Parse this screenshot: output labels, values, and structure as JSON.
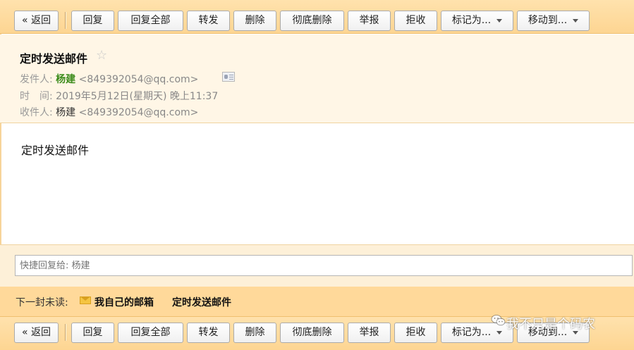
{
  "toolbar": {
    "back": "« 返回",
    "reply": "回复",
    "reply_all": "回复全部",
    "forward": "转发",
    "delete": "删除",
    "delete_permanent": "彻底删除",
    "report": "举报",
    "reject": "拒收",
    "mark_as": "标记为...",
    "move_to": "移动到..."
  },
  "mail": {
    "subject": "定时发送邮件",
    "star": "☆",
    "from_label": "发件人:",
    "from_name": "杨建",
    "from_email": "<849392054@qq.com>",
    "time_label": "时　间:",
    "time_value": "2019年5月12日(星期天) 晚上11:37",
    "to_label": "收件人:",
    "to_name": "杨建",
    "to_email": "<849392054@qq.com>",
    "body": "定时发送邮件"
  },
  "quick_reply": {
    "placeholder": "快捷回复给: 杨建"
  },
  "next_unread": {
    "label": "下一封未读:",
    "folder": "我自己的邮箱",
    "subject": "定时发送邮件"
  },
  "watermark": {
    "text": "我不只是个码农"
  },
  "colors": {
    "toolbar_bg": "#fdd592",
    "header_bg": "#fff6e6",
    "sender_green": "#3c8c1c"
  }
}
